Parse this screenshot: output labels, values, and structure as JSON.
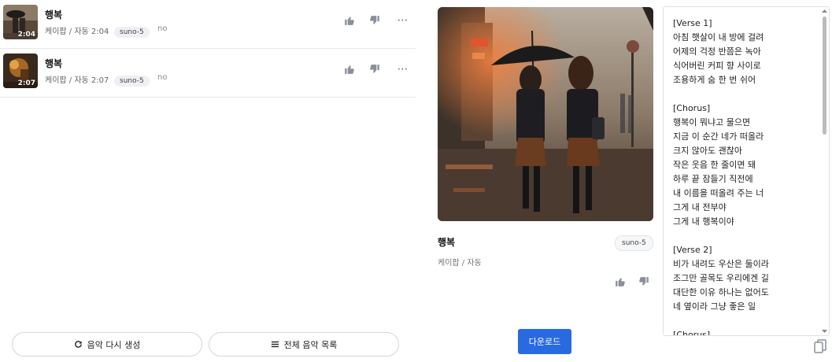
{
  "tracks": [
    {
      "title": "행복",
      "meta": "케이팝 / 자동  2:04",
      "duration": "2:04",
      "model": "suno-5",
      "extra": "no"
    },
    {
      "title": "행복",
      "meta": "케이팝 / 자동  2:07",
      "duration": "2:07",
      "model": "suno-5",
      "extra": "no"
    }
  ],
  "track_actions": {
    "like_icon": "thumbs-up-icon",
    "dislike_icon": "thumbs-down-icon",
    "more_icon": "more-horizontal-icon"
  },
  "buttons": {
    "regenerate_label": "음악 다시 생성",
    "full_list_label": "전체 음악 목록",
    "download_label": "다운로드"
  },
  "detail": {
    "title": "행복",
    "meta": "케이팝 / 자동",
    "model": "suno-5"
  },
  "lyrics": "[Verse 1]\n아침 햇살이 내 방에 걸려\n어제의 걱정 반쯤은 녹아\n식어버린 커피 향 사이로\n조용하게 숨 한 번 쉬어\n\n[Chorus]\n행복이 뭐냐고 물으면\n지금 이 순간 네가 떠올라\n크지 않아도 괜찮아\n작은 웃음 한 줄이면 돼\n하루 끝 잠들기 직전에\n내 이름을 떠올려 주는 너\n그게 내 전부야\n그게 내 행복이야\n\n[Verse 2]\n비가 내려도 우산은 둘이라\n조그만 골목도 우리에겐 길\n대단한 이유 하나는 없어도\n네 옆이라 그냥 좋은 일\n\n[Chorus]",
  "colors": {
    "accent": "#2a6ae0",
    "badge_bg": "#eef0f3",
    "icon": "#8a8f99"
  }
}
